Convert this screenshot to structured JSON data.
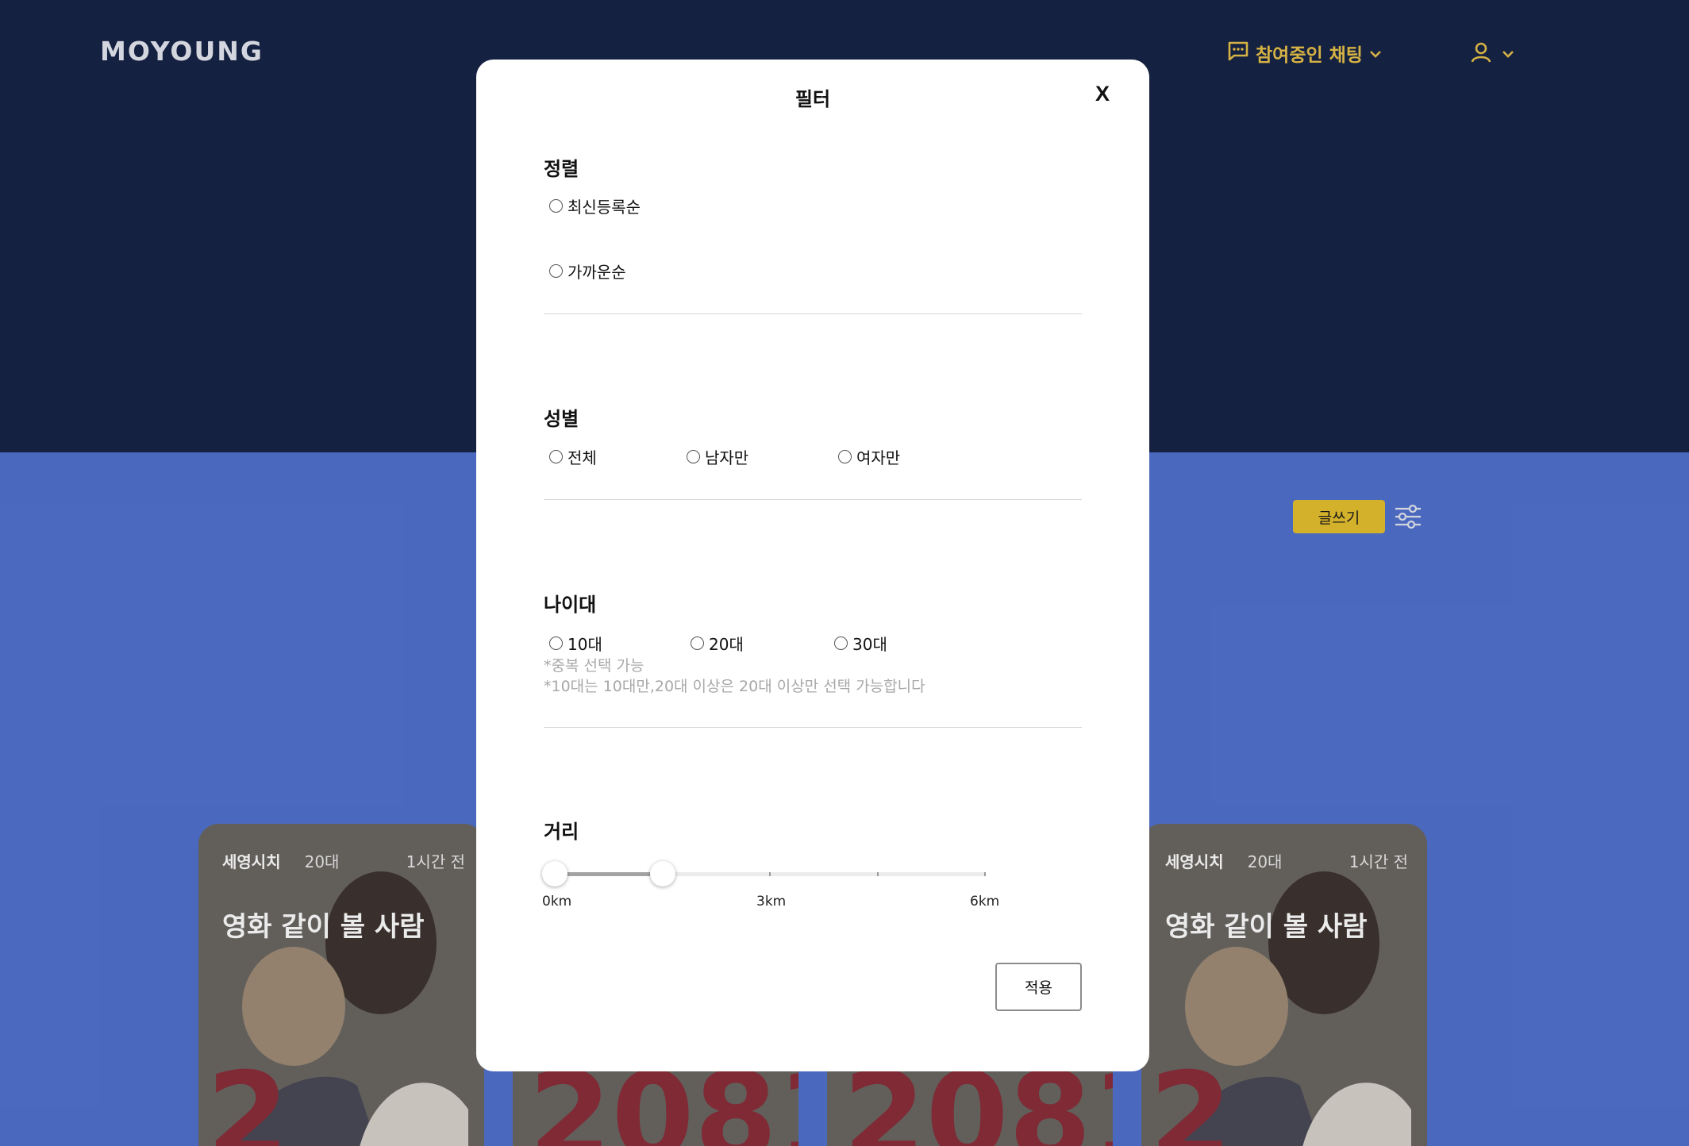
{
  "header": {
    "logo_text": "MOYOUNG",
    "chat_label": "참여중인 채팅",
    "accent_color": "#e8c24a"
  },
  "toolbar": {
    "write_label": "글쓰기"
  },
  "cards": [
    {
      "author": "세영시치",
      "age": "20대",
      "time": "1시간 전",
      "title": "영화 같이 볼 사람"
    },
    {
      "author": "",
      "age": "",
      "time": "",
      "title": ""
    },
    {
      "author": "",
      "age": "",
      "time": "",
      "title": ""
    },
    {
      "author": "세영시치",
      "age": "20대",
      "time": "1시간 전",
      "title": "영화 같이 볼 사람"
    }
  ],
  "modal": {
    "title": "필터",
    "close_label": "X",
    "sort": {
      "title": "정렬",
      "options": [
        "최신등록순",
        "가까운순"
      ]
    },
    "gender": {
      "title": "성별",
      "options": [
        "전체",
        "남자만",
        "여자만"
      ]
    },
    "age": {
      "title": "나이대",
      "options": [
        "10대",
        "20대",
        "30대"
      ],
      "hint1": "*중복 선택 가능",
      "hint2": "*10대는 10대만,20대 이상은 20대 이상만 선택 가능합니다"
    },
    "distance": {
      "title": "거리",
      "labels": [
        "0km",
        "3km",
        "6km"
      ],
      "range_min_km": 0,
      "range_max_km": 6,
      "selected_km": [
        0,
        1.5
      ]
    },
    "apply_label": "적용"
  }
}
